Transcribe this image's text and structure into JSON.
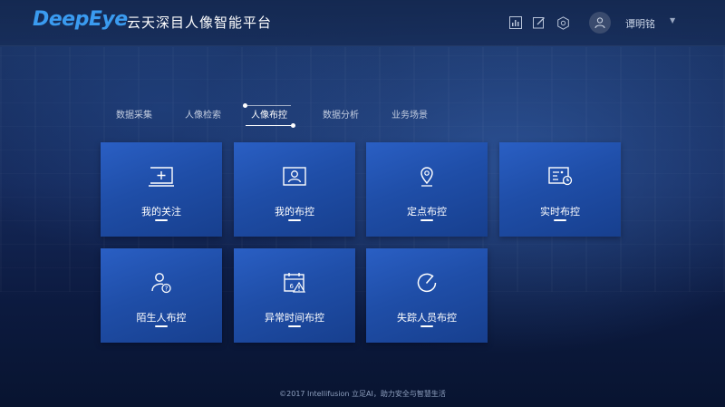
{
  "header": {
    "logo": "DeepEye",
    "title": "云天深目人像智能平台",
    "icons": [
      "bar-chart-icon",
      "edit-icon",
      "settings-icon"
    ],
    "username": "谭明铭"
  },
  "tabs": [
    {
      "label": "数据采集",
      "active": false
    },
    {
      "label": "人像检索",
      "active": false
    },
    {
      "label": "人像布控",
      "active": true
    },
    {
      "label": "数据分析",
      "active": false
    },
    {
      "label": "业务场景",
      "active": false
    }
  ],
  "tiles": [
    {
      "label": "我的关注",
      "icon": "add-box-icon"
    },
    {
      "label": "我的布控",
      "icon": "portrait-icon"
    },
    {
      "label": "定点布控",
      "icon": "location-pin-icon"
    },
    {
      "label": "实时布控",
      "icon": "realtime-panel-icon"
    },
    {
      "label": "陌生人布控",
      "icon": "stranger-question-icon"
    },
    {
      "label": "异常时间布控",
      "icon": "calendar-warning-icon"
    },
    {
      "label": "失踪人员布控",
      "icon": "circle-arrow-icon"
    }
  ],
  "footer": "©2017 Intellifusion 立足AI，助力安全与智慧生活",
  "colors": {
    "accent": "#3a9bf0",
    "tile": "#2457b8"
  }
}
